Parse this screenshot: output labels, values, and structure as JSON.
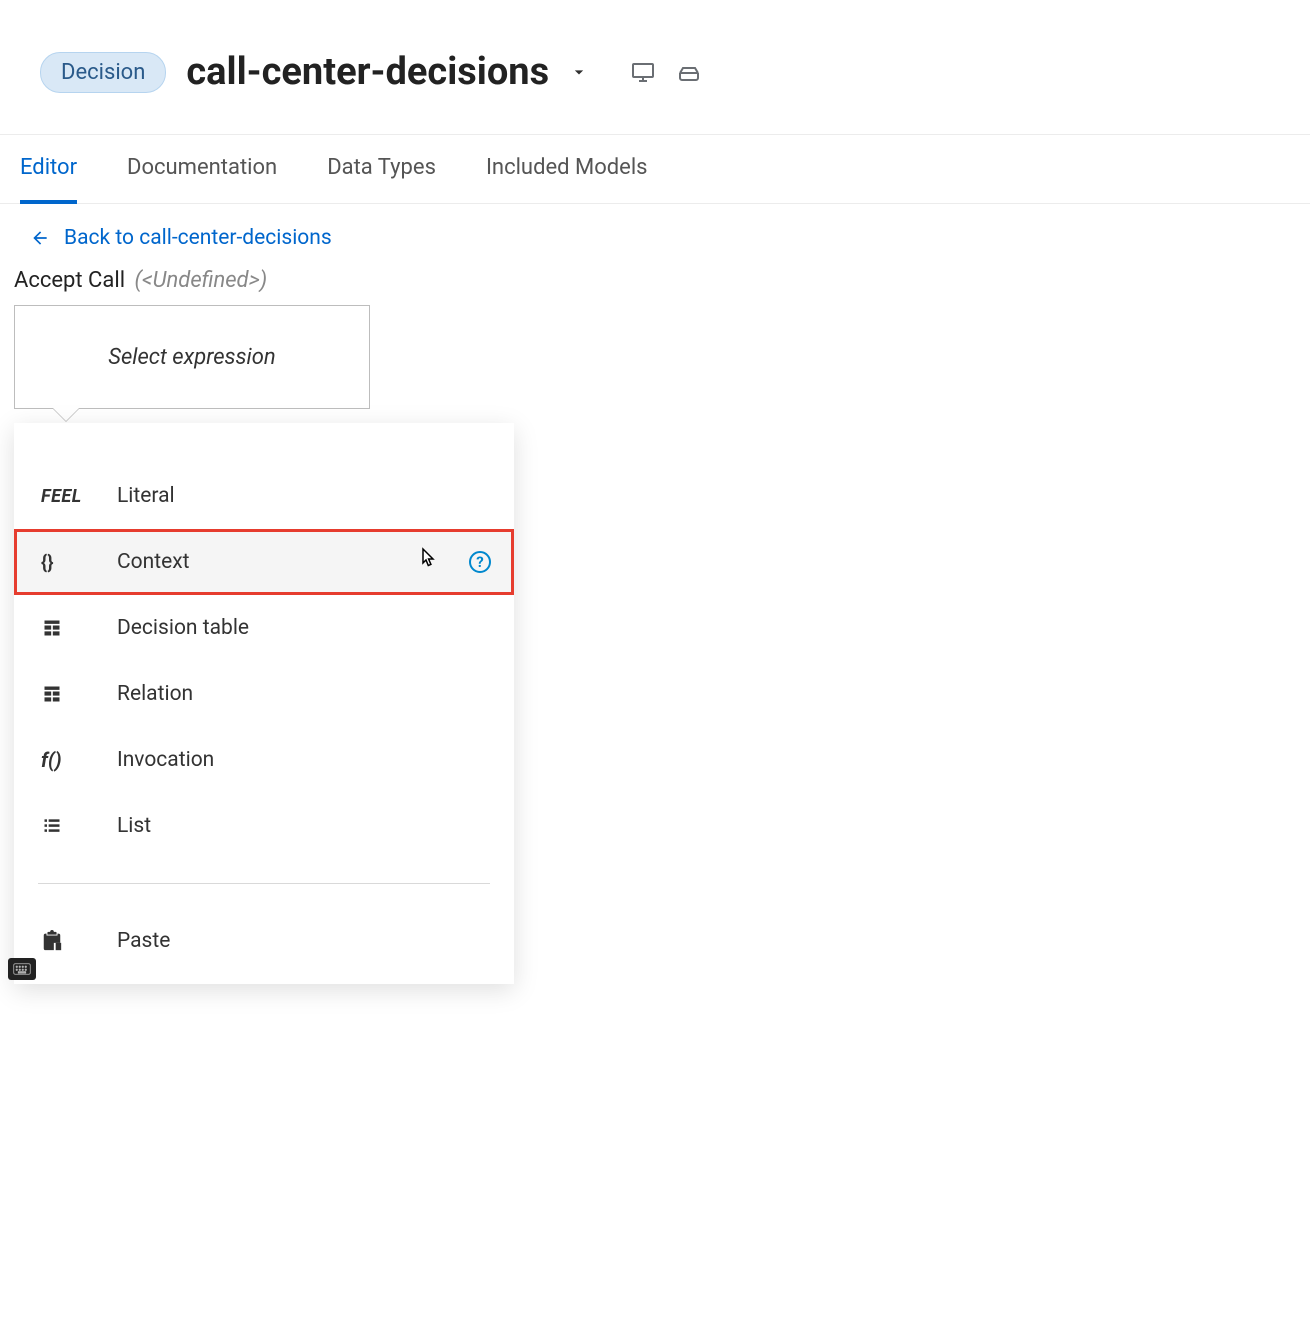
{
  "header": {
    "badge": "Decision",
    "title": "call-center-decisions"
  },
  "tabs": [
    {
      "label": "Editor",
      "active": true
    },
    {
      "label": "Documentation",
      "active": false
    },
    {
      "label": "Data Types",
      "active": false
    },
    {
      "label": "Included Models",
      "active": false
    }
  ],
  "breadcrumb": {
    "label": "Back to call-center-decisions"
  },
  "node": {
    "name": "Accept Call",
    "type": "(<Undefined>)"
  },
  "expression_placeholder": "Select expression",
  "menu": {
    "items": [
      {
        "icon": "feel",
        "label": "Literal",
        "highlight": false,
        "help": false
      },
      {
        "icon": "braces",
        "label": "Context",
        "highlight": true,
        "help": true
      },
      {
        "icon": "table",
        "label": "Decision table",
        "highlight": false,
        "help": false
      },
      {
        "icon": "table",
        "label": "Relation",
        "highlight": false,
        "help": false
      },
      {
        "icon": "invocation",
        "label": "Invocation",
        "highlight": false,
        "help": false
      },
      {
        "icon": "list",
        "label": "List",
        "highlight": false,
        "help": false
      }
    ],
    "paste_label": "Paste"
  }
}
